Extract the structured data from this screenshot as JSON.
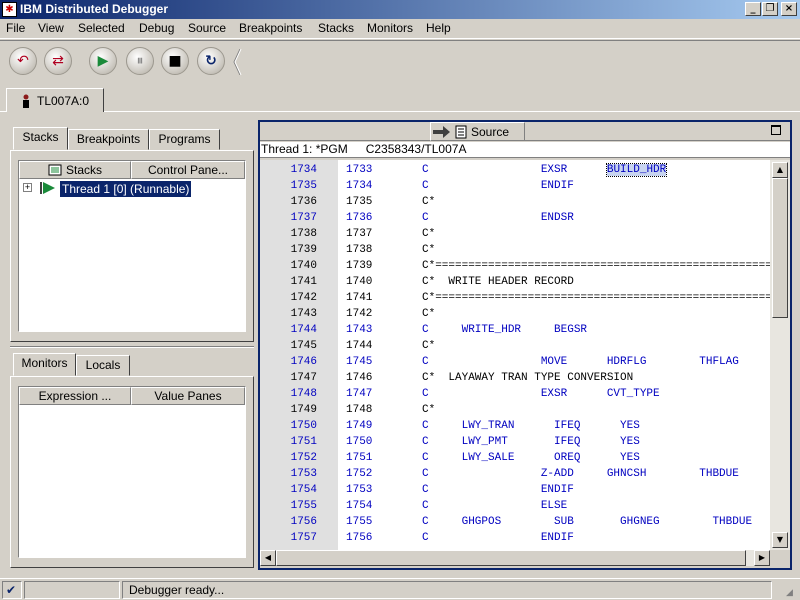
{
  "window": {
    "title": "IBM Distributed Debugger",
    "app_icon": "ibm-debugger-icon"
  },
  "menu": [
    "File",
    "View",
    "Selected",
    "Debug",
    "Source",
    "Breakpoints",
    "Stacks",
    "Monitors",
    "Help"
  ],
  "toolbar": {
    "buttons": [
      {
        "name": "step-over-icon",
        "glyph": "↶"
      },
      {
        "name": "step-into-icon",
        "glyph": "⇄"
      },
      {
        "name": "run-icon",
        "glyph": "▶"
      },
      {
        "name": "pause-icon",
        "glyph": "⏸"
      },
      {
        "name": "stop-icon",
        "glyph": "■"
      },
      {
        "name": "restart-icon",
        "glyph": "↻"
      }
    ]
  },
  "main_tab": {
    "label": "TL007A:0"
  },
  "left_top": {
    "tabs": [
      "Stacks",
      "Breakpoints",
      "Programs"
    ],
    "columns": [
      "Stacks",
      "Control Pane..."
    ],
    "tree_item": "Thread 1 [0] (Runnable)"
  },
  "left_bottom": {
    "tabs": [
      "Monitors",
      "Locals"
    ],
    "columns": [
      "Expression ...",
      "Value Panes"
    ]
  },
  "source_pane": {
    "title": "Source",
    "thread_label": "Thread 1: *PGM",
    "program": "C2358343/TL007A",
    "rows": [
      {
        "ln": "1734",
        "st": "1733",
        "code": "C                 EXSR      BUILD_HDR",
        "blue": true
      },
      {
        "ln": "1735",
        "st": "1734",
        "code": "C                 ENDIF",
        "blue": true
      },
      {
        "ln": "1736",
        "st": "1735",
        "code": "C*",
        "blue": false
      },
      {
        "ln": "1737",
        "st": "1736",
        "code": "C                 ENDSR",
        "blue": true
      },
      {
        "ln": "1738",
        "st": "1737",
        "code": "C*",
        "blue": false
      },
      {
        "ln": "1739",
        "st": "1738",
        "code": "C*",
        "blue": false
      },
      {
        "ln": "1740",
        "st": "1739",
        "code": "C*========================================================",
        "blue": false
      },
      {
        "ln": "1741",
        "st": "1740",
        "code": "C*  WRITE HEADER RECORD",
        "blue": false
      },
      {
        "ln": "1742",
        "st": "1741",
        "code": "C*========================================================",
        "blue": false
      },
      {
        "ln": "1743",
        "st": "1742",
        "code": "C*",
        "blue": false
      },
      {
        "ln": "1744",
        "st": "1743",
        "code": "C     WRITE_HDR     BEGSR",
        "blue": true
      },
      {
        "ln": "1745",
        "st": "1744",
        "code": "C*",
        "blue": false
      },
      {
        "ln": "1746",
        "st": "1745",
        "code": "C                 MOVE      HDRFLG        THFLAG",
        "blue": true
      },
      {
        "ln": "1747",
        "st": "1746",
        "code": "C*  LAYAWAY TRAN TYPE CONVERSION",
        "blue": false
      },
      {
        "ln": "1748",
        "st": "1747",
        "code": "C                 EXSR      CVT_TYPE",
        "blue": true
      },
      {
        "ln": "1749",
        "st": "1748",
        "code": "C*",
        "blue": false
      },
      {
        "ln": "1750",
        "st": "1749",
        "code": "C     LWY_TRAN      IFEQ      YES",
        "blue": true
      },
      {
        "ln": "1751",
        "st": "1750",
        "code": "C     LWY_PMT       IFEQ      YES",
        "blue": true
      },
      {
        "ln": "1752",
        "st": "1751",
        "code": "C     LWY_SALE      OREQ      YES",
        "blue": true
      },
      {
        "ln": "1753",
        "st": "1752",
        "code": "C                 Z-ADD     GHNCSH        THBDUE",
        "blue": true
      },
      {
        "ln": "1754",
        "st": "1753",
        "code": "C                 ENDIF",
        "blue": true
      },
      {
        "ln": "1755",
        "st": "1754",
        "code": "C                 ELSE",
        "blue": true
      },
      {
        "ln": "1756",
        "st": "1755",
        "code": "C     GHGPOS        SUB       GHGNEG        THBDUE",
        "blue": true
      },
      {
        "ln": "1757",
        "st": "1756",
        "code": "C                 ENDIF",
        "blue": true
      }
    ],
    "highlight_token": "BUILD_HDR"
  },
  "status": {
    "message": "Debugger ready...",
    "check_icon": "checkmark-icon"
  },
  "colors": {
    "title_start": "#0a246a",
    "title_end": "#a6caf0",
    "code_blue": "#0000c0",
    "face": "#d4d0c8",
    "focus_border": "#0a246a"
  }
}
